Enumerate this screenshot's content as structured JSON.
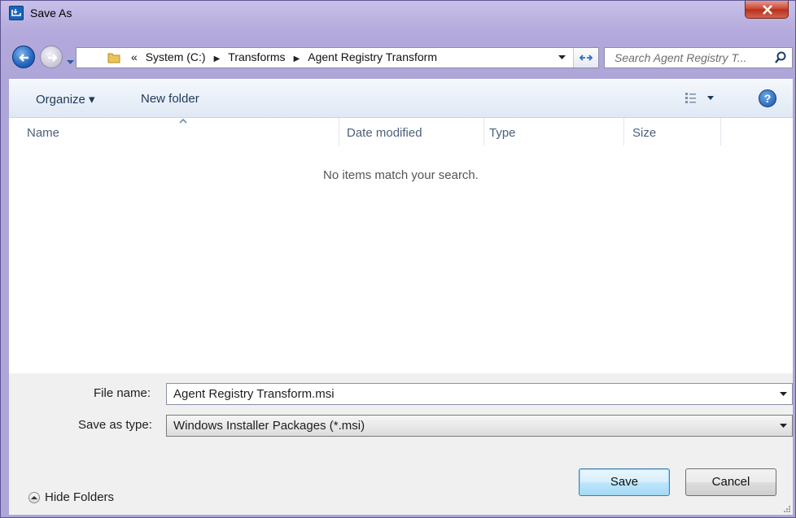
{
  "window": {
    "title": "Save As",
    "close_icon": "close-x-icon"
  },
  "address": {
    "breadcrumb_prefix": "«",
    "crumbs": [
      "System (C:)",
      "Transforms",
      "Agent Registry Transform"
    ],
    "search_placeholder": "Search Agent Registry T..."
  },
  "toolbar": {
    "organize_label": "Organize ▾",
    "new_folder_label": "New folder",
    "help_label": "?"
  },
  "columns": {
    "name": "Name",
    "date_modified": "Date modified",
    "type": "Type",
    "size": "Size"
  },
  "list": {
    "empty_message": "No items match your search."
  },
  "form": {
    "file_name_label": "File name:",
    "file_name_value": "Agent Registry Transform.msi",
    "save_type_label": "Save as type:",
    "save_type_value": "Windows Installer Packages (*.msi)"
  },
  "footer": {
    "hide_folders_label": "Hide Folders",
    "save_label": "Save",
    "cancel_label": "Cancel"
  },
  "colors": {
    "accent": "#3c7fb1",
    "close": "#c8422d",
    "frame": "#b3a9dc"
  }
}
